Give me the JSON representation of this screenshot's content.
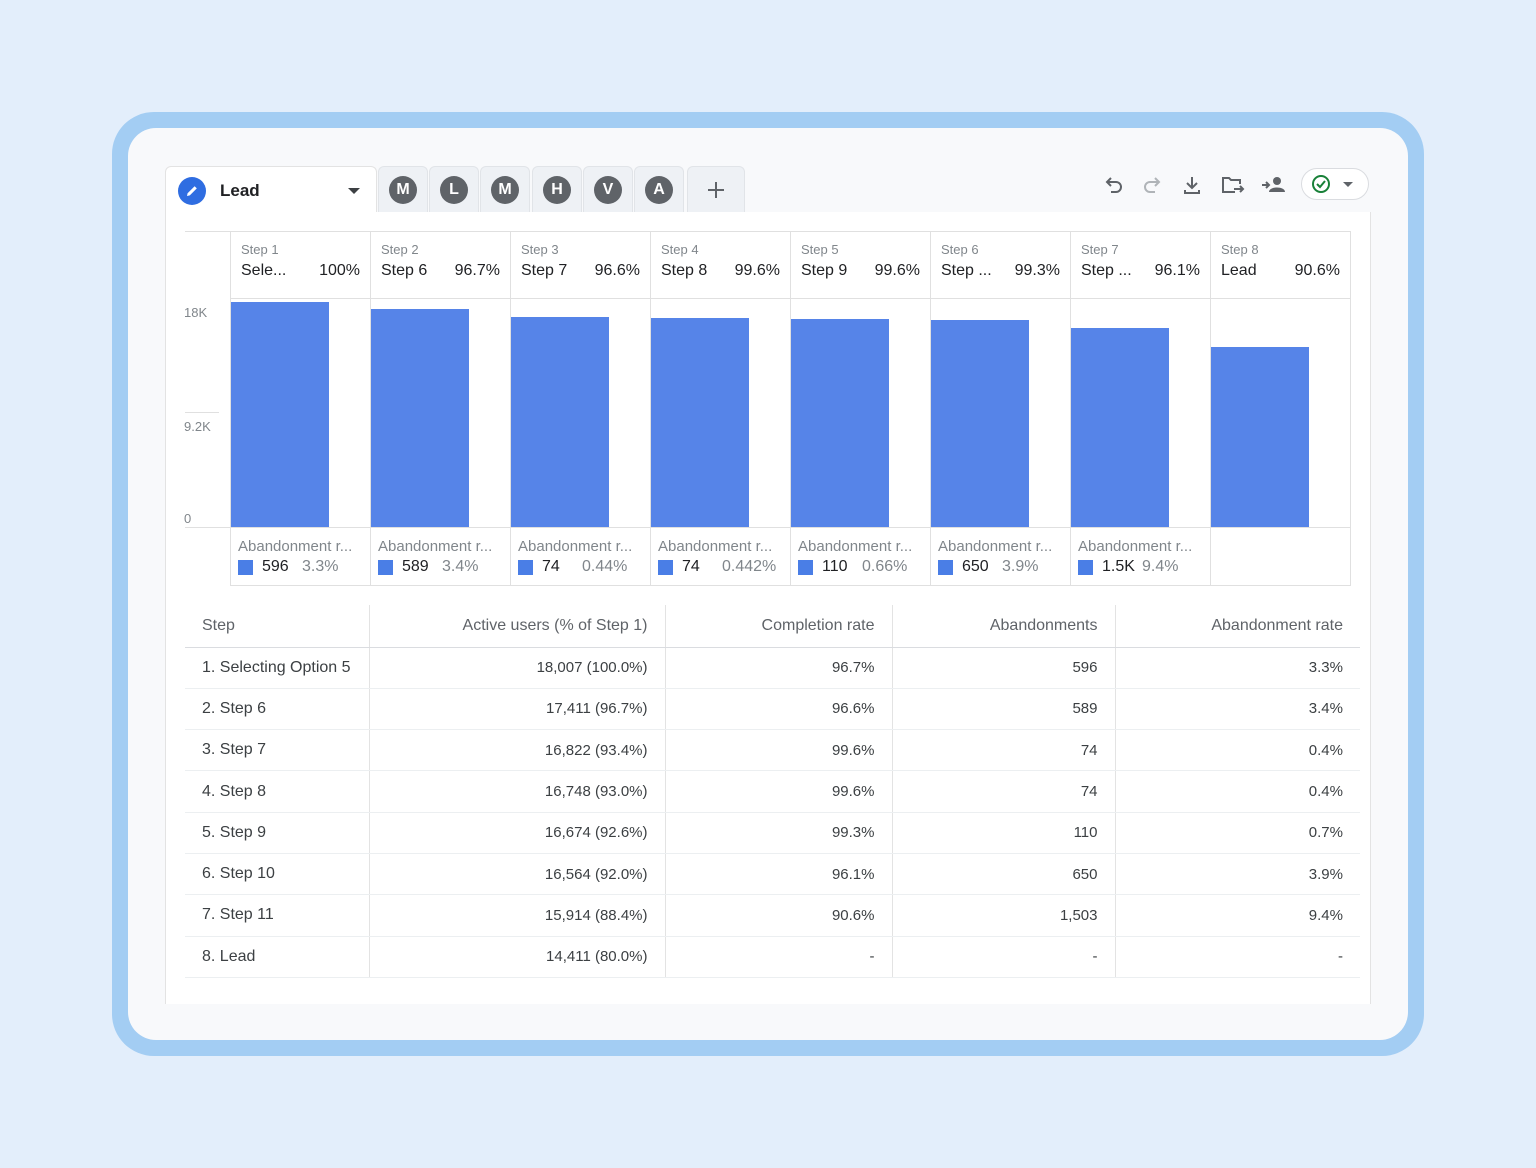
{
  "tabs": {
    "active_label": "Lead",
    "segments": [
      "M",
      "L",
      "M",
      "H",
      "V",
      "A"
    ],
    "add_label": "+"
  },
  "toolbar": {
    "icons": [
      "undo-icon",
      "redo-icon",
      "download-icon",
      "move-folder-icon",
      "share-users-icon",
      "check-circle-icon",
      "chevron-down-icon"
    ]
  },
  "colors": {
    "bar": "#5684e8",
    "accent": "#2f6de1",
    "status_ok": "#188038"
  },
  "chart_data": {
    "type": "bar",
    "y_ticks": [
      "18K",
      "9.2K",
      "0"
    ],
    "ylim": [
      0,
      18400
    ],
    "categories": [
      {
        "step": "Step 1",
        "name": "Sele...",
        "pct": "100%"
      },
      {
        "step": "Step 2",
        "name": "Step 6",
        "pct": "96.7%"
      },
      {
        "step": "Step 3",
        "name": "Step 7",
        "pct": "96.6%"
      },
      {
        "step": "Step 4",
        "name": "Step 8",
        "pct": "99.6%"
      },
      {
        "step": "Step 5",
        "name": "Step 9",
        "pct": "99.6%"
      },
      {
        "step": "Step 6",
        "name": "Step ...",
        "pct": "99.3%"
      },
      {
        "step": "Step 7",
        "name": "Step ...",
        "pct": "96.1%"
      },
      {
        "step": "Step 8",
        "name": "Lead",
        "pct": "90.6%"
      }
    ],
    "values": [
      18007,
      17411,
      16822,
      16748,
      16674,
      16564,
      15914,
      14411
    ],
    "abandonment": [
      {
        "label": "Abandonment r...",
        "count": "596",
        "rate": "3.3%"
      },
      {
        "label": "Abandonment r...",
        "count": "589",
        "rate": "3.4%"
      },
      {
        "label": "Abandonment r...",
        "count": "74",
        "rate": "0.44%"
      },
      {
        "label": "Abandonment r...",
        "count": "74",
        "rate": "0.442%"
      },
      {
        "label": "Abandonment r...",
        "count": "110",
        "rate": "0.66%"
      },
      {
        "label": "Abandonment r...",
        "count": "650",
        "rate": "3.9%"
      },
      {
        "label": "Abandonment r...",
        "count": "1.5K",
        "rate": "9.4%"
      }
    ]
  },
  "table": {
    "headers": [
      "Step",
      "Active users (% of Step 1)",
      "Completion rate",
      "Abandonments",
      "Abandonment rate"
    ],
    "rows": [
      [
        "1. Selecting Option 5",
        "18,007 (100.0%)",
        "96.7%",
        "596",
        "3.3%"
      ],
      [
        "2. Step 6",
        "17,411 (96.7%)",
        "96.6%",
        "589",
        "3.4%"
      ],
      [
        "3. Step 7",
        "16,822 (93.4%)",
        "99.6%",
        "74",
        "0.4%"
      ],
      [
        "4. Step 8",
        "16,748 (93.0%)",
        "99.6%",
        "74",
        "0.4%"
      ],
      [
        "5. Step 9",
        "16,674 (92.6%)",
        "99.3%",
        "110",
        "0.7%"
      ],
      [
        "6. Step 10",
        "16,564 (92.0%)",
        "96.1%",
        "650",
        "3.9%"
      ],
      [
        "7. Step 11",
        "15,914 (88.4%)",
        "90.6%",
        "1,503",
        "9.4%"
      ],
      [
        "8. Lead",
        "14,411 (80.0%)",
        "-",
        "-",
        "-"
      ]
    ]
  }
}
